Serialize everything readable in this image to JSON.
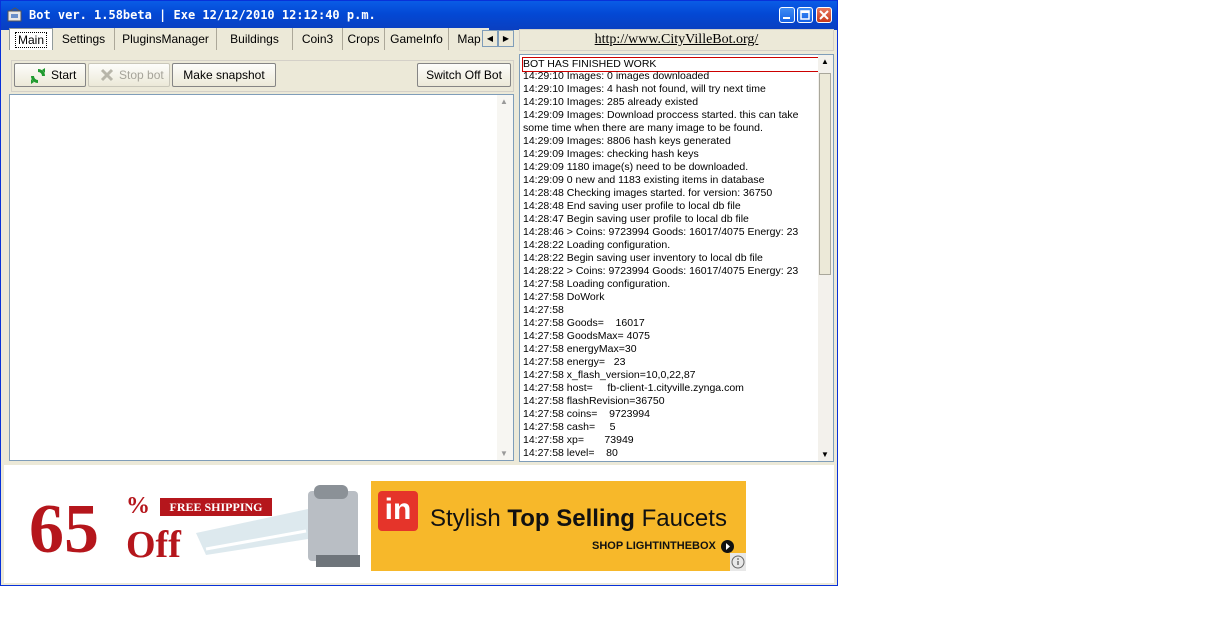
{
  "window": {
    "title": "Bot ver. 1.58beta | Exe 12/12/2010 12:12:40 p.m."
  },
  "tabs": [
    {
      "label": "Main",
      "active": true
    },
    {
      "label": "Settings"
    },
    {
      "label": "PluginsManager"
    },
    {
      "label": "Buildings"
    },
    {
      "label": "Coin3"
    },
    {
      "label": "Crops"
    },
    {
      "label": "GameInfo"
    },
    {
      "label": "Map"
    }
  ],
  "toolbar": {
    "start_label": "Start",
    "stop_label": "Stop bot",
    "snapshot_label": "Make snapshot",
    "switch_off_label": "Switch Off Bot"
  },
  "link": {
    "url_text": "http://www.CityVilleBot.org/"
  },
  "log": [
    "BOT HAS FINISHED WORK",
    "14:29:10 Images: 0 images downloaded",
    "14:29:10 Images: 4 hash not found, will try next time",
    "14:29:10 Images: 285 already existed",
    "14:29:09 Images: Download proccess started. this can take some time when there are many image to be found.",
    "14:29:09 Images: 8806 hash keys generated",
    "14:29:09 Images: checking hash keys",
    "14:29:09 1180 image(s) need to be downloaded.",
    "14:29:09 0 new and 1183 existing items in database",
    "14:28:48 Checking images started. for version: 36750",
    "14:28:48 End saving user profile to local db file",
    "14:28:47 Begin saving user profile to local db file",
    "14:28:46 > Coins: 9723994 Goods: 16017/4075 Energy: 23",
    "14:28:22 Loading configuration.",
    "14:28:22 Begin saving user inventory to local db file",
    "14:28:22 > Coins: 9723994 Goods: 16017/4075 Energy: 23",
    "14:27:58 Loading configuration.",
    "14:27:58 DoWork",
    "14:27:58",
    "14:27:58 Goods=    16017",
    "14:27:58 GoodsMax= 4075",
    "14:27:58 energyMax=30",
    "14:27:58 energy=   23",
    "14:27:58 x_flash_version=10,0,22,87",
    "14:27:58 host=     fb-client-1.cityville.zynga.com",
    "14:27:58 flashRevision=36750",
    "14:27:58 coins=    9723994",
    "14:27:58 cash=     5",
    "14:27:58 xp=       73949",
    "14:27:58 level=    80"
  ],
  "ad": {
    "percent": "65",
    "percent_sign": "%",
    "off": "Off",
    "free_shipping": "FREE SHIPPING",
    "logo_text": "in",
    "headline_pre": "Stylish ",
    "headline_bold": "Top Selling",
    "headline_post": " Faucets",
    "cta": "SHOP LIGHTINTHEBOX"
  },
  "colors": {
    "titlebar": "#0348d4",
    "ad_red": "#b5161c",
    "ad_yellow": "#f7b82a"
  }
}
